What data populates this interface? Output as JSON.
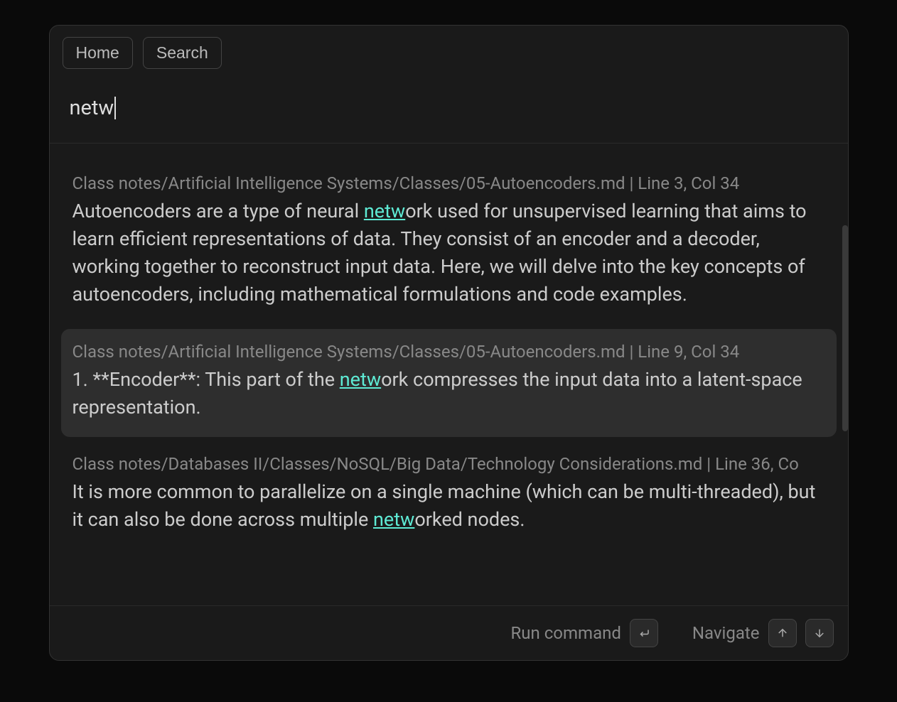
{
  "breadcrumbs": {
    "home": "Home",
    "search": "Search"
  },
  "search": {
    "query": "netw",
    "placeholder": ""
  },
  "results": [
    {
      "path": "Class notes/Artificial Intelligence Systems/Classes/05-Autoencoders.md | Line 3, Col 34",
      "text_before": "Autoencoders are a type of neural ",
      "match": "netw",
      "text_after": "ork used for unsupervised learning that aims to learn efficient representations of data. They consist of an encoder and a decoder, working together to reconstruct input data. Here, we will delve into the key concepts of autoencoders, including mathematical formulations and code examples.",
      "selected": false
    },
    {
      "path": "Class notes/Artificial Intelligence Systems/Classes/05-Autoencoders.md | Line 9, Col 34",
      "text_before": "1. **Encoder**: This part of the ",
      "match": "netw",
      "text_after": "ork compresses the input data into a latent-space representation.",
      "selected": true
    },
    {
      "path": "Class notes/Databases II/Classes/NoSQL/Big Data/Technology Considerations.md | Line 36, Co",
      "text_before": "It is more common to parallelize on a single machine (which can be multi-threaded), but it can also be done across multiple ",
      "match": "netw",
      "text_after": "orked nodes.",
      "selected": false
    }
  ],
  "footer": {
    "run_command": "Run command",
    "navigate": "Navigate"
  }
}
